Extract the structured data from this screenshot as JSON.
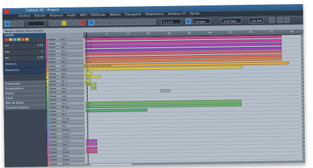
{
  "window": {
    "title": "Cubase SX - Project"
  },
  "menu": [
    "Archivo",
    "Edición",
    "Proyecto",
    "Audio",
    "MIDI",
    "Partituras",
    "Medios",
    "Transporte",
    "Dispositivos",
    "Ventana (7)",
    "Ayuda"
  ],
  "toolbar": {
    "position": "1.1.1.0",
    "snap": "Compás",
    "quantize": "1/16 Nota",
    "tempo": "120.000"
  },
  "infoline": {
    "text": "Ningún Objeto Seleccionado"
  },
  "inspector": {
    "header": "AUDIO",
    "rows": [
      {
        "label": "vol",
        "value": "0.00"
      },
      {
        "label": "pan",
        "value": "C"
      },
      {
        "label": "del",
        "value": "0.00"
      },
      {
        "label": "in",
        "value": "Stereo In"
      },
      {
        "label": "out",
        "value": "Stereo Out"
      }
    ],
    "sections": [
      "Inserciones",
      "Ecualizadores",
      "Envíos",
      "Canal",
      "Bloc de Notas",
      "Controles Rápidos"
    ]
  },
  "ruler": {
    "ticks": [
      "1",
      "9",
      "17",
      "25",
      "33",
      "41",
      "49",
      "57",
      "65",
      "73",
      "81"
    ]
  },
  "tracks": [
    {
      "name": "Kick",
      "color": "#d74a8e"
    },
    {
      "name": "Snare",
      "color": "#d74a8e"
    },
    {
      "name": "Hat",
      "color": "#cc4aa0"
    },
    {
      "name": "Tom 1",
      "color": "#c44a9a"
    },
    {
      "name": "Tom 2",
      "color": "#b74ab4"
    },
    {
      "name": "Tom 3",
      "color": "#a64ac0"
    },
    {
      "name": "OH L",
      "color": "#d2607a"
    },
    {
      "name": "OH R",
      "color": "#d86862"
    },
    {
      "name": "Room",
      "color": "#de7b52"
    },
    {
      "name": "Bass",
      "color": "#e6a23a"
    },
    {
      "name": "Gtr 1",
      "color": "#e0c63a"
    },
    {
      "name": "Gtr 2",
      "color": "#c9cf4c"
    },
    {
      "name": "Gtr 3",
      "color": "#a9c760"
    },
    {
      "name": "Keys",
      "color": "#9bbf5e"
    },
    {
      "name": "Pad",
      "color": "#8fb85c"
    },
    {
      "name": "Lead",
      "color": "#7db05c"
    },
    {
      "name": "Vox 1",
      "color": "#6aa75e"
    },
    {
      "name": "Vox 2",
      "color": "#5ea06a"
    },
    {
      "name": "Bk Vox",
      "color": "#5b9c78"
    },
    {
      "name": "FX 1",
      "color": "#5a9888"
    },
    {
      "name": "FX 2",
      "color": "#5a9497"
    },
    {
      "name": "Strings",
      "color": "#5a90a8"
    },
    {
      "name": "Brass",
      "color": "#5a8bbb"
    },
    {
      "name": "Perc",
      "color": "#5b86c9"
    },
    {
      "name": "Group 1",
      "color": "#6b7cd0"
    },
    {
      "name": "Group 2",
      "color": "#7c72cf"
    },
    {
      "name": "FX Ch 1",
      "color": "#8b68c9"
    },
    {
      "name": "FX Ch 2",
      "color": "#9a5fc0"
    },
    {
      "name": "Out 1",
      "color": "#a85ab5"
    },
    {
      "name": "Out 2",
      "color": "#b556a8"
    },
    {
      "name": "Marker",
      "color": "#c25499"
    },
    {
      "name": "Video",
      "color": "#cc5488"
    },
    {
      "name": "Tempo",
      "color": "#d15a78"
    },
    {
      "name": "Master",
      "color": "#d6666a"
    }
  ],
  "parts": [
    {
      "label": "Drums",
      "color": "#d84d9a"
    },
    {
      "label": "Drums",
      "color": "#c94cab"
    },
    {
      "label": "Drums",
      "color": "#b54cc0"
    },
    {
      "label": "Drums",
      "color": "#9f4cc8"
    },
    {
      "label": "OH",
      "color": "#e06677"
    },
    {
      "label": "OH",
      "color": "#e47262"
    },
    {
      "label": "Room",
      "color": "#e78a52"
    },
    {
      "label": "Bass - Main Take (Fade Audio)",
      "color": "#f0b040"
    },
    {
      "label": "Gtr",
      "color": "#e8d24a"
    },
    {
      "label": "",
      "color": "#d7e25a"
    },
    {
      "label": "Gtr 2",
      "color": "#d9dc5c"
    },
    {
      "label": "",
      "color": "#c5d560"
    },
    {
      "label": "Keys",
      "color": "#b5cd62"
    },
    {
      "label": "",
      "color": "#9fc865"
    },
    {
      "label": "",
      "color": "#a6b3bf"
    },
    {
      "label": "Vox",
      "color": "#7dc06b"
    },
    {
      "label": "Vox",
      "color": "#6ebb76"
    },
    {
      "label": "Bk",
      "color": "#62b583"
    },
    {
      "label": "",
      "color": "#b060c8"
    },
    {
      "label": "",
      "color": "#c05cb4"
    },
    {
      "label": "",
      "color": "#cd5aa0"
    },
    {
      "label": "",
      "color": "#d65a8a"
    }
  ]
}
